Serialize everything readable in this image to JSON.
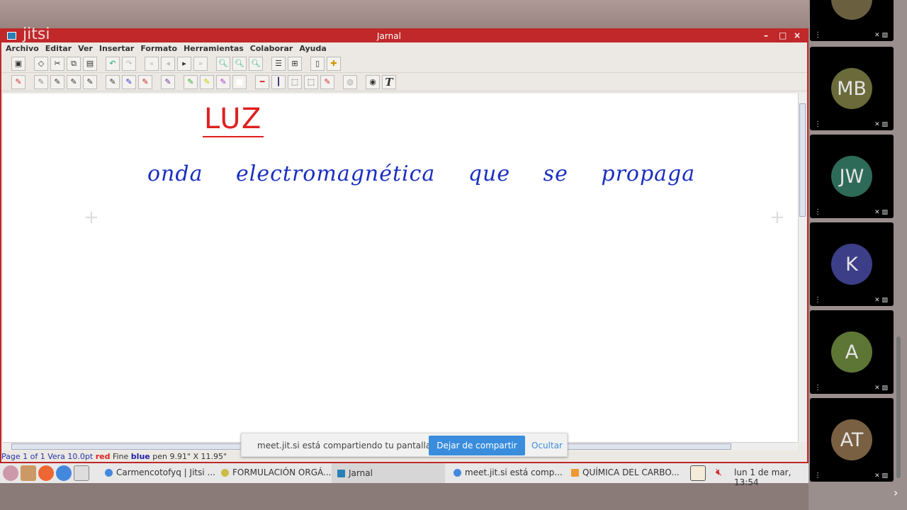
{
  "window": {
    "title": "Jarnal",
    "logo": "jitsi",
    "controls": [
      "–",
      "□",
      "×"
    ]
  },
  "menu": [
    "Archivo",
    "Editar",
    "Ver",
    "Insertar",
    "Formato",
    "Herramientas",
    "Colaborar",
    "Ayuda"
  ],
  "canvas": {
    "heading": "LUZ",
    "line": "onda electromagnética que se propaga",
    "heading_color": "#e02020",
    "ink_color": "#1a2fc0"
  },
  "status": {
    "page": "Page 1 of 1 Vera 10.0pt",
    "color1": "red",
    "fine": "Fine",
    "color2": "blue",
    "pen": "pen",
    "size": "9.91\" X 11.95\""
  },
  "notification": {
    "message": "meet.jit.si está compartiendo tu pantalla.",
    "stop": "Dejar de compartir",
    "hide": "Ocultar"
  },
  "taskbar": {
    "tasks": [
      "Carmencotofyq | Jitsi ...",
      "FORMULACIÓN ORGÁ...",
      "Jarnal",
      "meet.jit.si está comp...",
      "QUÍMICA DEL CARBO..."
    ],
    "clock": "lun 1 de mar, 13:54"
  },
  "participants": [
    {
      "initials": "MB",
      "color": "#6a6a3a"
    },
    {
      "initials": "JW",
      "color": "#2e6a58"
    },
    {
      "initials": "K",
      "color": "#3c3e88"
    },
    {
      "initials": "A",
      "color": "#5d7636"
    },
    {
      "initials": "AT",
      "color": "#7a6042"
    }
  ]
}
